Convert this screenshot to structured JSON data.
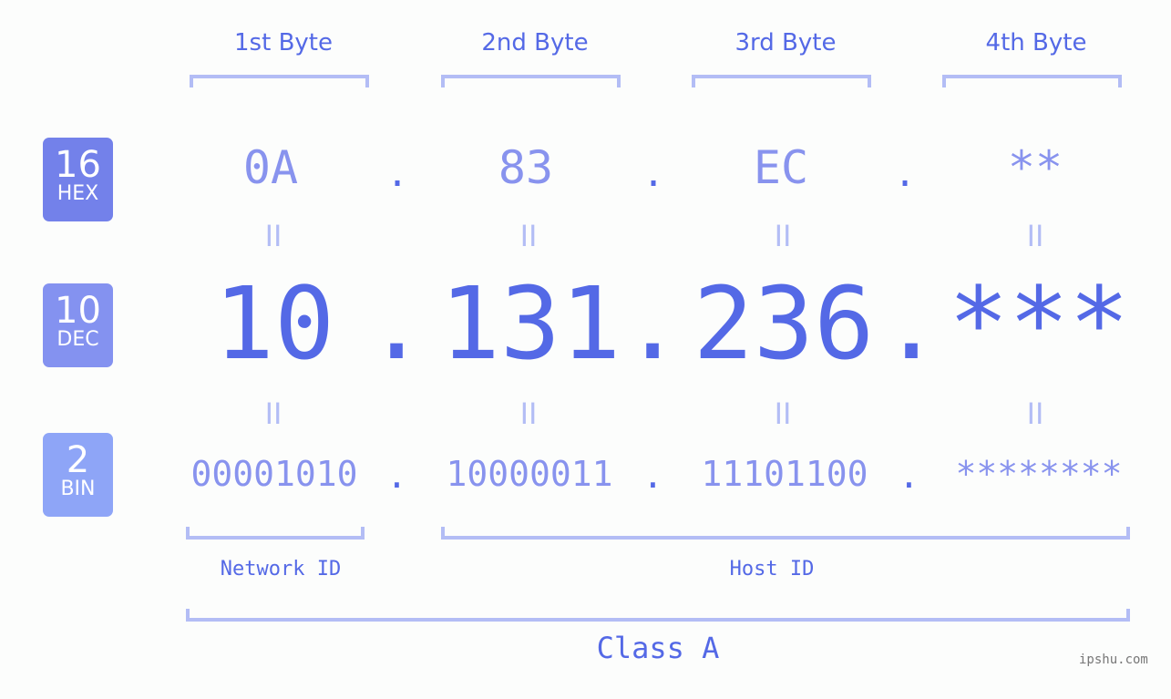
{
  "byte_headers": [
    "1st Byte",
    "2nd Byte",
    "3rd Byte",
    "4th Byte"
  ],
  "badges": {
    "hex": {
      "num": "16",
      "label": "HEX",
      "color": "#7381ea"
    },
    "dec": {
      "num": "10",
      "label": "DEC",
      "color": "#8492f0"
    },
    "bin": {
      "num": "2",
      "label": "BIN",
      "color": "#8ea5f7"
    }
  },
  "hex_values": [
    "0A",
    "83",
    "EC",
    "**"
  ],
  "dec_values": [
    "10",
    "131",
    "236",
    "***"
  ],
  "bin_values": [
    "00001010",
    "10000011",
    "11101100",
    "********"
  ],
  "separator": ".",
  "equals": "II",
  "network_label": "Network ID",
  "host_label": "Host ID",
  "class_label": "Class A",
  "watermark": "ipshu.com",
  "colors": {
    "primary": "#5469e6",
    "secondary": "#8893ee",
    "bracket": "#b3bdf5"
  }
}
